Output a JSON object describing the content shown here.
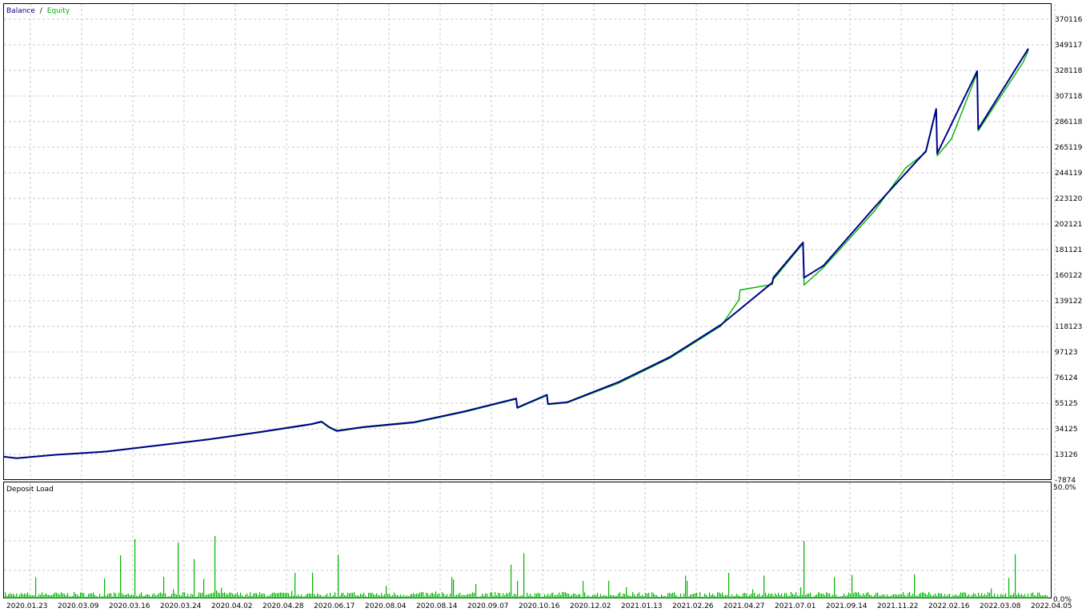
{
  "colors": {
    "balance": "#00008b",
    "equity": "#00b400",
    "deposit_load": "#00b400",
    "grid": "#c8c8c8",
    "frame": "#000000",
    "legend_sep": "#000000"
  },
  "chart_data": [
    {
      "type": "line",
      "legend": [
        {
          "name": "Balance",
          "color": "#00008b"
        },
        {
          "name": "Equity",
          "color": "#00b400"
        }
      ],
      "legend_separator": "/",
      "legend_position": "top-left",
      "ylim": [
        -7874,
        391115
      ],
      "y_ticks": [
        "370116",
        "349117",
        "328118",
        "307118",
        "286118",
        "265119",
        "244119",
        "223120",
        "202121",
        "181121",
        "160122",
        "139122",
        "118123",
        "97123",
        "76124",
        "55125",
        "34125",
        "13126",
        "-7874"
      ],
      "x_ticks": [
        "2020.01.23",
        "2020.03.09",
        "2020.03.16",
        "2020.03.24",
        "2020.04.02",
        "2020.04.28",
        "2020.06.17",
        "2020.08.04",
        "2020.08.14",
        "2020.09.07",
        "2020.10.16",
        "2020.12.02",
        "2021.01.13",
        "2021.02.26",
        "2021.04.27",
        "2021.07.01",
        "2021.09.14",
        "2021.11.22",
        "2022.02.16",
        "2022.03.08",
        "2022.04.05"
      ],
      "grid": true,
      "series": [
        {
          "name": "Balance",
          "x_index": [
            0,
            0.25,
            1,
            2,
            3,
            4,
            5,
            6,
            6.2,
            6.35,
            6.5,
            7,
            8,
            9,
            10,
            10.02,
            10.6,
            10.62,
            11,
            12,
            13,
            14,
            15,
            15.02,
            15.6,
            15.62,
            16,
            17,
            18,
            18.2,
            18.22,
            19,
            19.02,
            20
          ],
          "values": [
            11200,
            10000,
            12800,
            15500,
            20500,
            25500,
            31500,
            38000,
            40000,
            35500,
            32500,
            35500,
            39500,
            48500,
            59000,
            51500,
            62000,
            54500,
            56000,
            72500,
            93000,
            119500,
            154000,
            158000,
            187000,
            158000,
            168000,
            216000,
            262000,
            296500,
            260000,
            327500,
            280000,
            346000
          ]
        },
        {
          "name": "Equity",
          "x_index": [
            0,
            0.25,
            1,
            2,
            3,
            4,
            5,
            6,
            6.2,
            6.35,
            6.5,
            7,
            8,
            9,
            10,
            10.02,
            10.6,
            10.62,
            11,
            12,
            13,
            14,
            14.35,
            14.37,
            15,
            15.02,
            15.6,
            15.62,
            16,
            17,
            17.6,
            18,
            18.2,
            18.22,
            18.5,
            19,
            19.02,
            19.9,
            20
          ],
          "values": [
            11000,
            9800,
            12600,
            15200,
            20200,
            25200,
            31200,
            37600,
            39600,
            35000,
            32000,
            35100,
            39000,
            48000,
            58500,
            51000,
            61500,
            54000,
            55500,
            71500,
            92000,
            118500,
            140000,
            148000,
            152500,
            156500,
            186000,
            152000,
            166500,
            213000,
            248000,
            261000,
            295500,
            258000,
            272000,
            326000,
            278500,
            335000,
            344500
          ]
        }
      ]
    },
    {
      "type": "bar",
      "title": "Deposit Load",
      "ylim": [
        0,
        50
      ],
      "y_ticks": [
        "50.0%",
        "0.0%"
      ],
      "grid": true
    }
  ]
}
